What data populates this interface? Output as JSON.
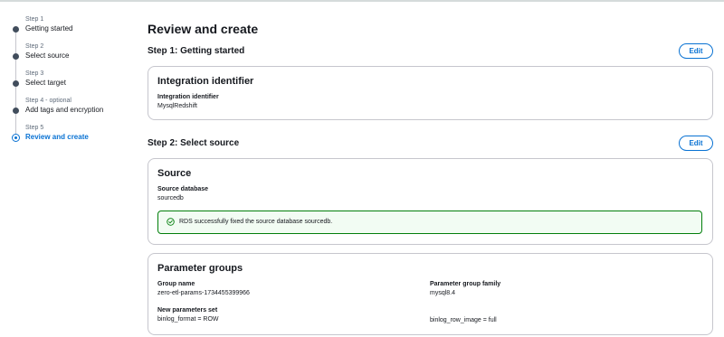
{
  "wizard": {
    "steps": [
      {
        "number": "Step 1",
        "title": "Getting started"
      },
      {
        "number": "Step 2",
        "title": "Select source"
      },
      {
        "number": "Step 3",
        "title": "Select target"
      },
      {
        "number": "Step 4 - optional",
        "title": "Add tags and encryption"
      },
      {
        "number": "Step 5",
        "title": "Review and create"
      }
    ],
    "active_step": 5
  },
  "main": {
    "page_title": "Review and create",
    "step1": {
      "heading": "Step 1: Getting started",
      "edit_label": "Edit",
      "card": {
        "title": "Integration identifier",
        "field_label": "Integration identifier",
        "field_value": "MysqlRedshift"
      }
    },
    "step2": {
      "heading": "Step 2: Select source",
      "edit_label": "Edit",
      "source_card": {
        "title": "Source",
        "field_label": "Source database",
        "field_value": "sourcedb",
        "alert": {
          "icon": "success-check-icon",
          "message": "RDS successfully fixed the source database sourcedb."
        }
      },
      "parameter_card": {
        "title": "Parameter groups",
        "group_name_label": "Group name",
        "group_name_value": "zero-etl-params-1734455399966",
        "family_label": "Parameter group family",
        "family_value": "mysql8.4",
        "new_params_label": "New parameters set",
        "params": [
          "binlog_format = ROW",
          "binlog_row_image = full"
        ]
      }
    }
  },
  "colors": {
    "accent": "#0972d3",
    "success": "#037f0c",
    "success_bg": "#f2fcf3",
    "border": "#c6c6cd",
    "text": "#16191f",
    "muted": "#5f6b7a"
  }
}
